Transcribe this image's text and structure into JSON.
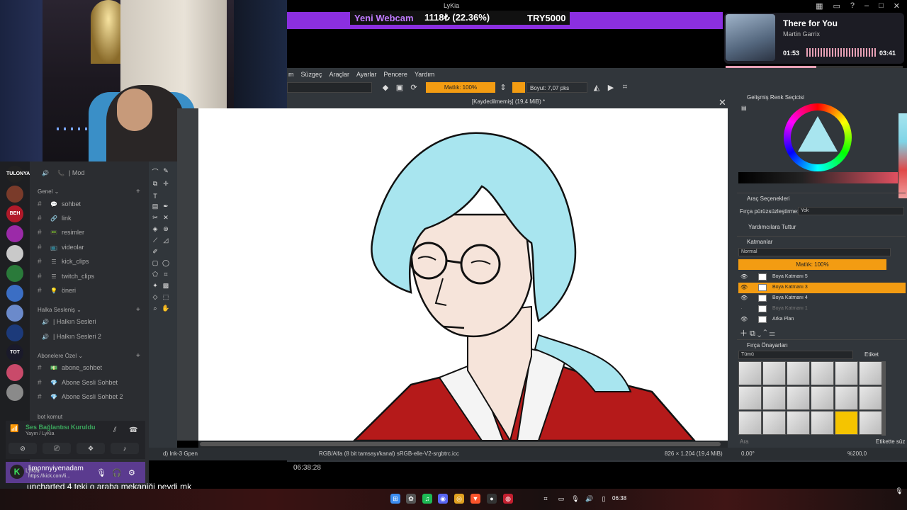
{
  "stream": {
    "window_title": "LyKia",
    "alert_label": "Yeni Webcam",
    "alert_amount": "1118₺ (22.36%)",
    "alert_goal": "TRY5000",
    "timer": "06:38:28",
    "caption": "uncharted 4 teki o araba mekaniği neydi mk"
  },
  "spotify": {
    "song": "There for You",
    "artist": "Martin Garrix",
    "elapsed": "01:53",
    "duration": "03:41",
    "progress_fraction": 0.51
  },
  "krita": {
    "menu": [
      "m",
      "Seçim",
      "Süzgeç",
      "Araçlar",
      "Ayarlar",
      "Pencere",
      "Yardım"
    ],
    "toolbar": {
      "opacity_label": "Matlık: 100%",
      "size_label": "Boyut: 7,07 pks"
    },
    "doc_title": "[Kaydedilmemiş] (19,4 MiB) *",
    "status": {
      "brush": "d) Ink-3 Gpen",
      "color_space": "RGB/Alfa (8 bit tamsayı/kanal) sRGB-elle-V2-srgbtrc.icc",
      "dimensions": "826 × 1.204 (19,4 MiB)",
      "rotation": "0,00°",
      "zoom": "%200,0"
    },
    "dockers": {
      "color_selector": "Gelişmiş Renk Seçicisi",
      "tool_options": "Araç Seçenekleri",
      "brush_smoothing_label": "Fırça pürüzsüzleştirme:",
      "brush_smoothing_value": "Yok",
      "assistant_label": "Yardımcılara Tuttur",
      "layers": "Katmanlar",
      "blend_mode": "Normal",
      "layer_opacity": "Matlık: 100%",
      "layer_list": [
        {
          "name": "Boya Katmanı 5",
          "selected": false,
          "hidden": false
        },
        {
          "name": "Boya Katmanı 3",
          "selected": true,
          "hidden": false
        },
        {
          "name": "Boya Katmanı 4",
          "selected": false,
          "hidden": false
        },
        {
          "name": "Boya Katmanı 1",
          "selected": false,
          "hidden": true
        },
        {
          "name": "Arka Plan",
          "selected": false,
          "hidden": false
        }
      ],
      "brush_presets": "Fırça Önayarları",
      "brush_filter": "Tümü",
      "tag_label": "Etiket",
      "search_placeholder": "Ara",
      "tag_search": "Etikette süz"
    }
  },
  "discord": {
    "top_channel": "| Mod",
    "categories": [
      {
        "name": "Genel",
        "channels": [
          {
            "emoji": "💬",
            "name": "sohbet"
          },
          {
            "emoji": "🔗",
            "name": "link"
          },
          {
            "emoji": "📟",
            "name": "resimler"
          },
          {
            "emoji": "📺",
            "name": "videolar"
          },
          {
            "emoji": "☰",
            "name": "kick_clips"
          },
          {
            "emoji": "☰",
            "name": "twitch_clips"
          },
          {
            "emoji": "💡",
            "name": "öneri"
          }
        ]
      },
      {
        "name": "Halka Sesleniş",
        "channels": [
          {
            "emoji": "🔊",
            "name": "| Halkın Sesleri"
          },
          {
            "emoji": "🔊",
            "name": "| Halkın Sesleri 2"
          }
        ]
      },
      {
        "name": "Abonelere Özel",
        "channels": [
          {
            "emoji": "💵",
            "name": "abone_sohbet"
          },
          {
            "emoji": "💎",
            "name": "Abone Sesli Sohbet"
          },
          {
            "emoji": "💎",
            "name": "Abone Sesli Sohbet 2"
          }
        ]
      }
    ],
    "next_category": "bot komut",
    "voice_status": "Ses Bağlantısı Kuruldu",
    "voice_sub": "Yayın / LyKia",
    "user_name": "limonnyiyenadam",
    "user_name_ghost": "LyKia",
    "user_sub": "https://kick.com/li...",
    "servers": [
      "TULONYA",
      "",
      "BEH",
      "",
      "",
      "",
      "",
      "",
      "",
      "TOT",
      "",
      ""
    ]
  },
  "taskbar": {
    "clock": "06:38"
  },
  "colors": {
    "accent_orange": "#f39c12",
    "stream_purple": "#8b2fe0",
    "discord_green": "#3ba55c"
  }
}
